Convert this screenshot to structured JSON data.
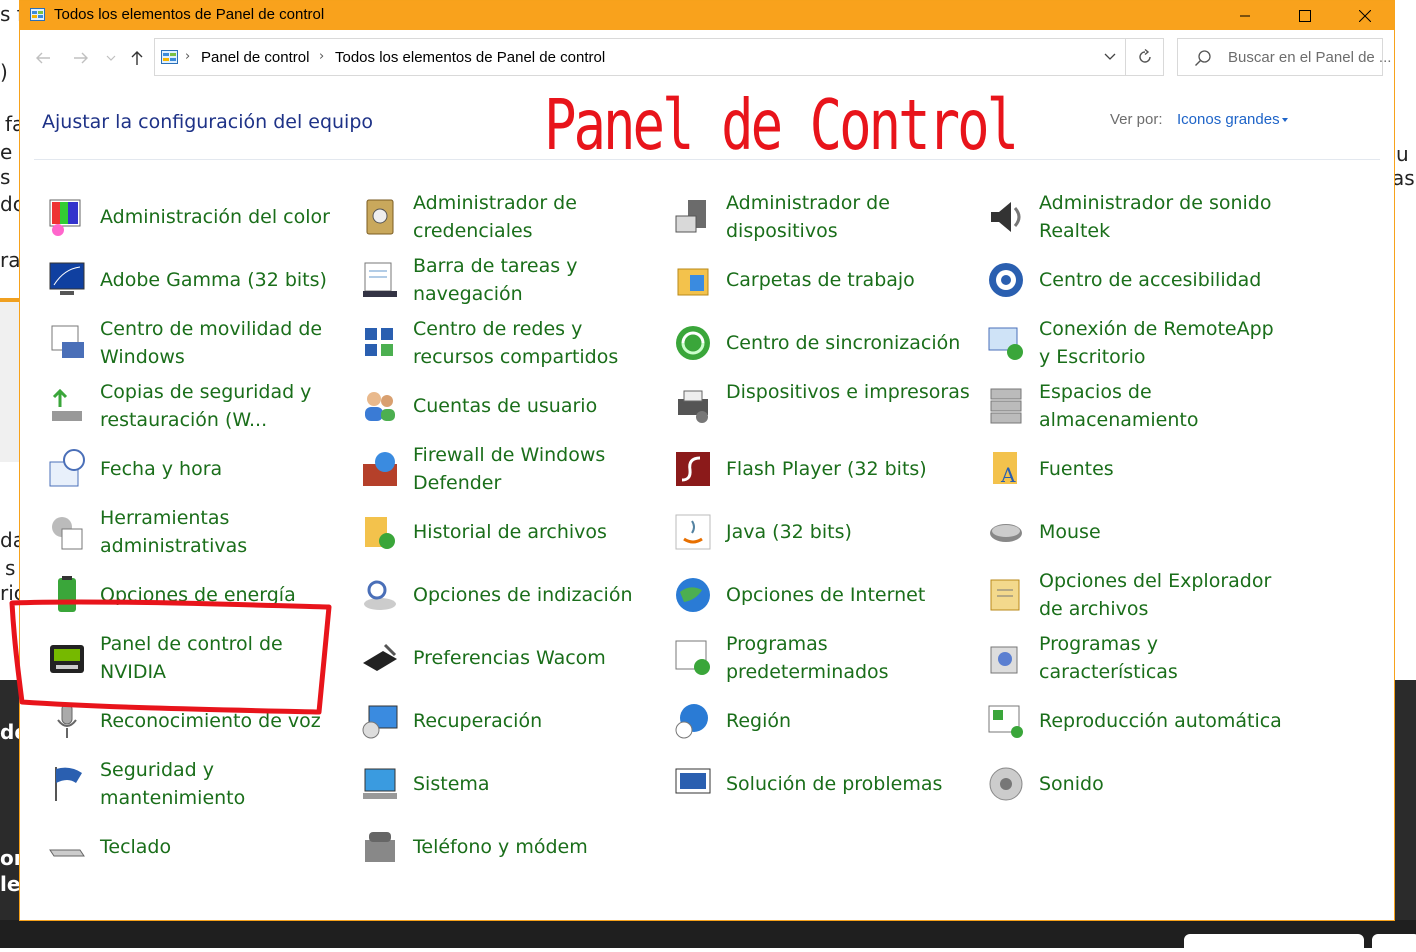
{
  "window": {
    "title": "Todos los elementos de Panel de control",
    "titlebar_color": "#f9a21c",
    "controls": [
      "minimize",
      "maximize",
      "close"
    ]
  },
  "navigation": {
    "back_icon": "arrow-left-icon",
    "forward_icon": "arrow-right-icon",
    "up_icon": "arrow-up-icon",
    "breadcrumb": [
      "Panel de control",
      "Todos los elementos de Panel de control"
    ],
    "search_placeholder": "Buscar en el Panel de ..."
  },
  "header": {
    "heading": "Ajustar la configuración del equipo",
    "overlay_title": "Panel de Control",
    "overlay_color": "#e8141b",
    "view_by_label": "Ver por:",
    "view_by_value": "Iconos grandes"
  },
  "background": {
    "left_fragments": [
      "s f",
      ")",
      "fa",
      "e",
      "s",
      "dc",
      "ra",
      "da",
      "s",
      "ric",
      "de",
      "on",
      "le"
    ],
    "right_fragments": [
      "u",
      "as"
    ]
  },
  "items": [
    [
      "Administración del color",
      "Administrador de credenciales",
      "Administrador de dispositivos",
      "Administrador de sonido Realtek"
    ],
    [
      "Adobe Gamma (32 bits)",
      "Barra de tareas y navegación",
      "Carpetas de trabajo",
      "Centro de accesibilidad"
    ],
    [
      "Centro de movilidad de Windows",
      "Centro de redes y recursos compartidos",
      "Centro de sincronización",
      "Conexión de RemoteApp y Escritorio"
    ],
    [
      "Copias de seguridad y restauración (W...",
      "Cuentas de usuario",
      "Dispositivos e impresoras",
      "Espacios de almacenamiento"
    ],
    [
      "Fecha y hora",
      "Firewall de Windows Defender",
      "Flash Player (32 bits)",
      "Fuentes"
    ],
    [
      "Herramientas administrativas",
      "Historial de archivos",
      "Java (32 bits)",
      "Mouse"
    ],
    [
      "Opciones de energía",
      "Opciones de indización",
      "Opciones de Internet",
      "Opciones del Explorador de archivos"
    ],
    [
      "Panel de control de NVIDIA",
      "Preferencias Wacom",
      "Programas predeterminados",
      "Programas y características"
    ],
    [
      "Reconocimiento de voz",
      "Recuperación",
      "Región",
      "Reproducción automática"
    ],
    [
      "Seguridad y mantenimiento",
      "Sistema",
      "Solución de problemas",
      "Sonido"
    ],
    [
      "Teclado",
      "Teléfono y módem",
      "",
      ""
    ]
  ],
  "item_label_color": "#1a6e1a",
  "highlight_color": "#e8141b"
}
